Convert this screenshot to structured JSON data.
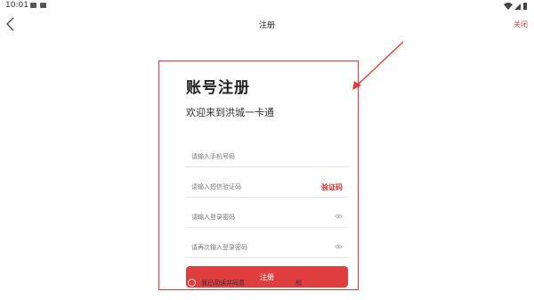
{
  "status_bar": {
    "time": "10:01",
    "icons": [
      "image-icon",
      "a-icon",
      "wifi-icon",
      "signal-icon",
      "battery-icon"
    ]
  },
  "nav": {
    "title": "注册",
    "close_label": "关闭"
  },
  "form": {
    "title": "账号注册",
    "subtitle": "欢迎来到洪城一卡通",
    "phone_placeholder": "请输入手机号码",
    "sms_placeholder": "请输入短信验证码",
    "verify_code_label": "验证码",
    "password_placeholder": "请输入登录密码",
    "confirm_password_placeholder": "请再次输入登录密码",
    "register_label": "注册",
    "agree_text": "我已阅读并同意",
    "agree_and": "和"
  },
  "colors": {
    "accent": "#e03e3e",
    "annotation": "#e53935"
  }
}
